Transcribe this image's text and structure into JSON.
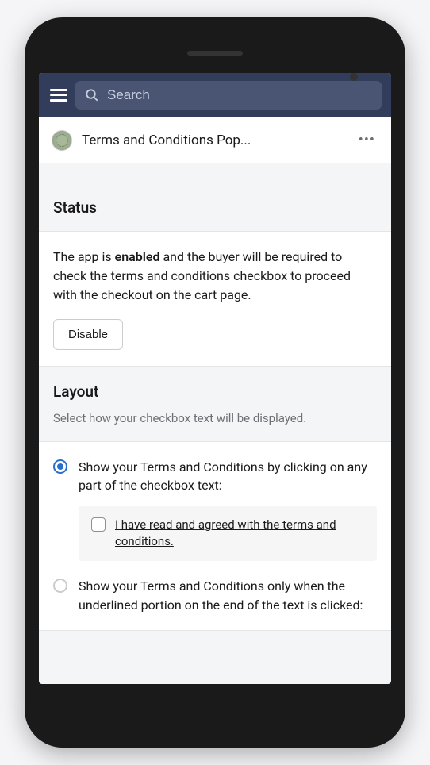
{
  "topbar": {
    "search_placeholder": "Search"
  },
  "header": {
    "app_title": "Terms and Conditions Pop..."
  },
  "status": {
    "title": "Status",
    "text_before": "The app is ",
    "text_bold": "enabled",
    "text_after": " and the buyer will be required to check the terms and conditions checkbox to proceed with the checkout on the cart page.",
    "disable_label": "Disable"
  },
  "layout": {
    "title": "Layout",
    "subtitle": "Select how your checkbox text will be displayed.",
    "option1": {
      "label": "Show your Terms and Conditions by clicking on any part of the checkbox text:",
      "example": "I have read and agreed with the terms and conditions."
    },
    "option2": {
      "label": "Show your Terms and Conditions only when the underlined portion on the end of the text is clicked:"
    }
  }
}
